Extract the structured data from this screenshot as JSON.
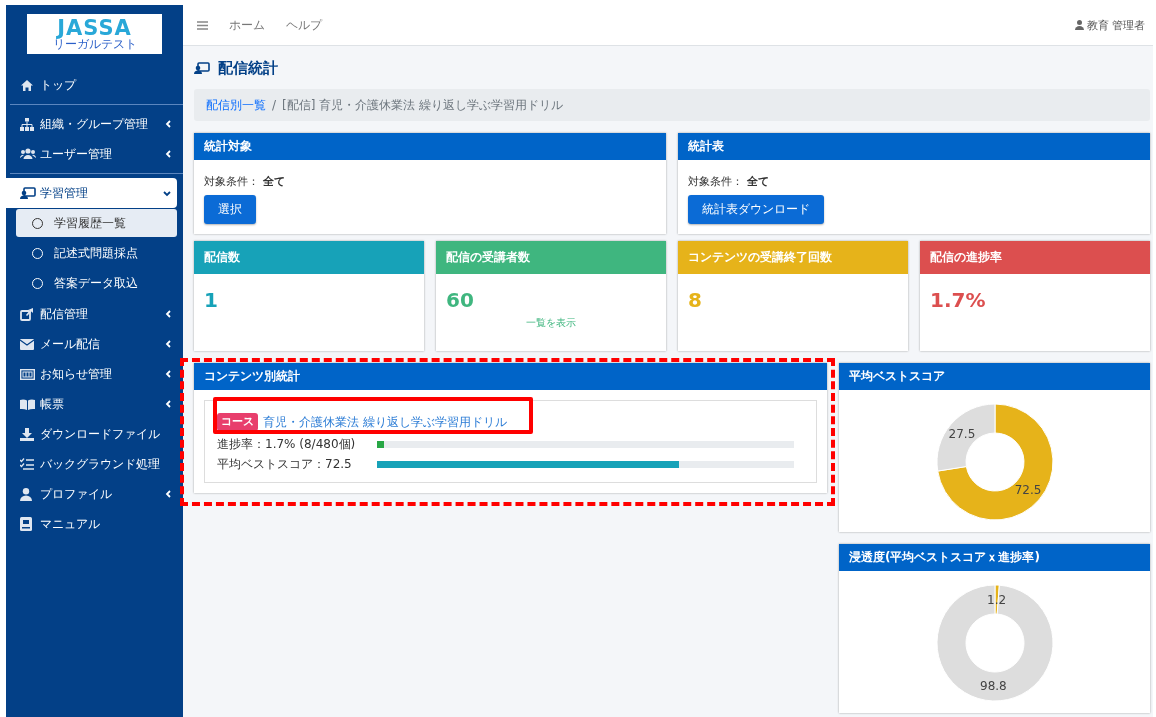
{
  "sidebar": {
    "logo": {
      "title": "JASSA",
      "subtitle": "リーガルテスト"
    },
    "items": [
      {
        "label": "トップ",
        "has_submenu": false,
        "selected": false
      },
      {
        "label": "組織・グループ管理",
        "has_submenu": true,
        "selected": false,
        "expanded": false
      },
      {
        "label": "ユーザー管理",
        "has_submenu": true,
        "selected": false,
        "expanded": false
      },
      {
        "label": "学習管理",
        "has_submenu": true,
        "selected": true,
        "expanded": true,
        "children": [
          {
            "label": "学習履歴一覧",
            "selected": true
          },
          {
            "label": "記述式問題採点",
            "selected": false
          },
          {
            "label": "答案データ取込",
            "selected": false
          }
        ]
      },
      {
        "label": "配信管理",
        "has_submenu": true,
        "selected": false,
        "expanded": false
      },
      {
        "label": "メール配信",
        "has_submenu": true,
        "selected": false,
        "expanded": false
      },
      {
        "label": "お知らせ管理",
        "has_submenu": true,
        "selected": false,
        "expanded": false
      },
      {
        "label": "帳票",
        "has_submenu": true,
        "selected": false,
        "expanded": false
      },
      {
        "label": "ダウンロードファイル",
        "has_submenu": false,
        "selected": false
      },
      {
        "label": "バックグラウンド処理",
        "has_submenu": false,
        "selected": false
      },
      {
        "label": "プロファイル",
        "has_submenu": true,
        "selected": false,
        "expanded": false
      },
      {
        "label": "マニュアル",
        "has_submenu": false,
        "selected": false
      }
    ]
  },
  "topbar": {
    "links": [
      "ホーム",
      "ヘルプ"
    ],
    "user": "教育 管理者"
  },
  "page_title": "配信統計",
  "breadcrumb": {
    "separator": "/",
    "items": [
      {
        "label": "配信別一覧",
        "kind": "link"
      },
      {
        "label": "[配信] 育児・介護休業法 繰り返し学ぶ学習用ドリル",
        "kind": "current"
      }
    ]
  },
  "filter_panels": [
    {
      "title": "統計対象",
      "condition_label": "対象条件：",
      "condition_value": "全て",
      "button": "選択"
    },
    {
      "title": "統計表",
      "condition_label": "対象条件：",
      "condition_value": "全て",
      "button": "統計表ダウンロード"
    }
  ],
  "stat_cards": [
    {
      "title": "配信数",
      "value": "1",
      "color": "#17a2b8"
    },
    {
      "title": "配信の受講者数",
      "value": "60",
      "color": "#3fb67f",
      "link": "一覧を表示"
    },
    {
      "title": "コンテンツの受講終了回数",
      "value": "8",
      "color": "#e6b31a"
    },
    {
      "title": "配信の進捗率",
      "value": "1.7%",
      "color": "#dc4f4f"
    }
  ],
  "content_stats": {
    "title": "コンテンツ別統計",
    "items": [
      {
        "badge": "コース",
        "name": "育児・介護休業法 繰り返し学ぶ学習用ドリル",
        "metrics": [
          {
            "label": "進捗率：1.7% (8/480個)",
            "level": 0.017,
            "color": "#28a745"
          },
          {
            "label": "平均ベストスコア：72.5",
            "level": 0.725,
            "color": "#17a2b8"
          }
        ]
      }
    ]
  },
  "charts": [
    {
      "title": "平均ベストスコア",
      "chart_data": {
        "type": "donut",
        "values": [
          72.5,
          27.5
        ],
        "data_labels": true
      }
    },
    {
      "title": "浸透度(平均ベストスコアｘ進捗率)",
      "chart_data": {
        "type": "donut",
        "values": [
          1.2,
          98.8
        ],
        "data_labels": true
      }
    }
  ]
}
